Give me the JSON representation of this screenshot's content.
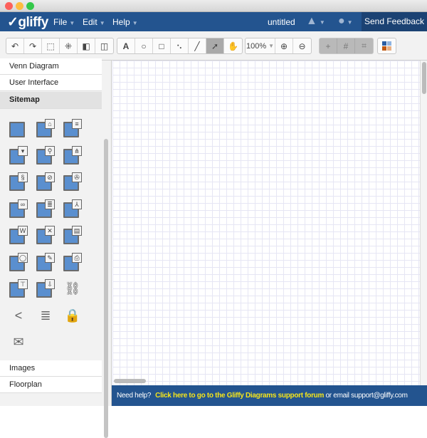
{
  "window": {
    "controls": [
      "close",
      "minimize",
      "zoom"
    ]
  },
  "header": {
    "logo": "gliffy",
    "menus": [
      "File",
      "Edit",
      "Help"
    ],
    "doc_title": "untitled",
    "send_feedback": "Send Feedback"
  },
  "toolbar": {
    "edit_group": [
      "undo-icon",
      "redo-icon",
      "select-group-icon",
      "ungroup-icon",
      "bring-front-icon",
      "send-back-icon"
    ],
    "draw_group": [
      "text-icon",
      "ellipse-icon",
      "rectangle-icon",
      "connector-icon",
      "line-icon",
      "pointer-icon",
      "hand-icon"
    ],
    "active_tool": "pointer-icon",
    "zoom": "100%",
    "grid_group": [
      "crosshair-icon",
      "grid-icon",
      "snap-icon"
    ],
    "theme": "theme-icon"
  },
  "sidebar": {
    "top_items": [
      "Venn Diagram",
      "User Interface"
    ],
    "section": "Sitemap",
    "shapes": [
      "page",
      "home",
      "text-page",
      "form",
      "search",
      "sitemap",
      "scroll",
      "compass",
      "media",
      "game",
      "document",
      "pdf",
      "word",
      "excel",
      "powerpoint",
      "comment",
      "edit",
      "print",
      "table",
      "download",
      "link",
      "share",
      "database",
      "lock",
      "email"
    ],
    "bottom_items": [
      "Images",
      "Floorplan"
    ]
  },
  "footer": {
    "prefix": "Need help?",
    "link": "Click here to go to the Gliffy Diagrams support forum",
    "suffix": " or email support@gliffy.com"
  }
}
